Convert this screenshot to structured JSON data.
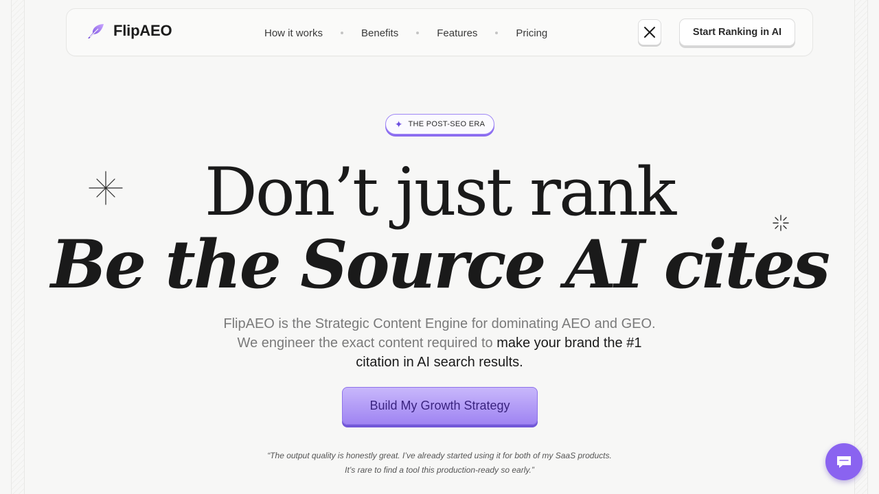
{
  "brand": {
    "name": "FlipAEO",
    "accent": "#8b6cf0"
  },
  "nav": {
    "links": [
      "How it works",
      "Benefits",
      "Features",
      "Pricing"
    ],
    "x_icon": "x-twitter-icon",
    "cta_label": "Start Ranking in AI"
  },
  "hero": {
    "badge": "THE POST-SEO ERA",
    "badge_icon": "sparkle-icon",
    "headline_line1": "Don’t just rank",
    "headline_line2": "Be the Source AI cites",
    "sub_muted": "FlipAEO is the Strategic Content Engine for dominating AEO and GEO. We engineer the exact content required to ",
    "sub_emphasis": "make your brand the #1 citation in AI search results.",
    "cta_label": "Build My Growth Strategy",
    "testimonial_line1": "“The output quality is honestly great. I’ve already started using it for both of my SaaS products.",
    "testimonial_line2": "It’s rare to find a tool this production-ready so early.”"
  },
  "chat": {
    "icon": "chat-bubble-icon"
  }
}
